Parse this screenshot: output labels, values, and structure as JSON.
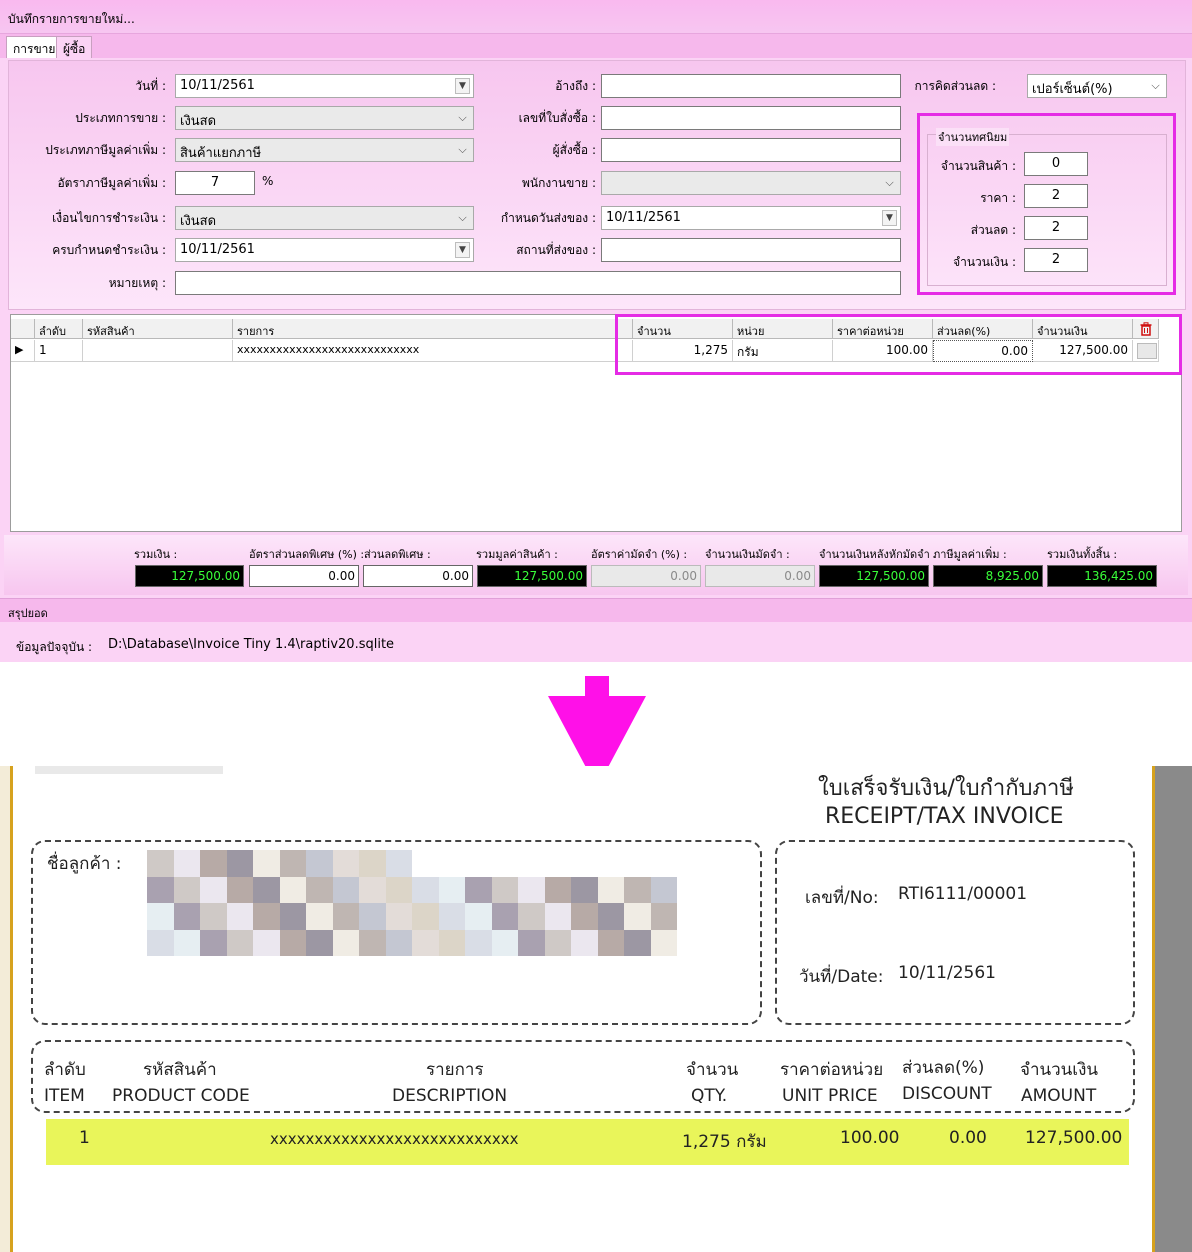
{
  "window": {
    "title": "บันทึกรายการขายใหม่..."
  },
  "tabs": [
    {
      "label": "การขาย",
      "active": true
    },
    {
      "label": "ผู้ซื้อ",
      "active": false
    }
  ],
  "form": {
    "date_label": "วันที่ :",
    "date_value": "10/11/2561",
    "sale_type_label": "ประเภทการขาย :",
    "sale_type_value": "เงินสด",
    "vat_type_label": "ประเภทภาษีมูลค่าเพิ่ม :",
    "vat_type_value": "สินค้าแยกภาษี",
    "vat_rate_label": "อัตราภาษีมูลค่าเพิ่ม :",
    "vat_rate_value": "7",
    "vat_rate_unit": "%",
    "payment_terms_label": "เงื่อนไขการชำระเงิน :",
    "payment_terms_value": "เงินสด",
    "due_date_label": "ครบกำหนดชำระเงิน :",
    "due_date_value": "10/11/2561",
    "remark_label": "หมายเหตุ :",
    "remark_value": "",
    "reference_label": "อ้างถึง :",
    "reference_value": "",
    "po_number_label": "เลขที่ใบสั่งซื้อ :",
    "po_number_value": "",
    "orderer_label": "ผู้สั่งซื้อ :",
    "orderer_value": "",
    "salesperson_label": "พนักงานขาย :",
    "salesperson_value": "",
    "delivery_date_label": "กำหนดวันส่งของ :",
    "delivery_date_value": "10/11/2561",
    "delivery_place_label": "สถานที่ส่งของ :",
    "delivery_place_value": "",
    "discount_calc_label": "การคิดส่วนลด :",
    "discount_calc_value": "เปอร์เซ็นต์(%)"
  },
  "decimals": {
    "title": "จำนวนทศนิยม",
    "qty_label": "จำนวนสินค้า :",
    "qty_value": "0",
    "price_label": "ราคา :",
    "price_value": "2",
    "discount_label": "ส่วนลด :",
    "discount_value": "2",
    "amount_label": "จำนวนเงิน :",
    "amount_value": "2"
  },
  "grid": {
    "headers": {
      "seq": "ลำดับ",
      "code": "รหัสสินค้า",
      "desc": "รายการ",
      "qty": "จำนวน",
      "unit": "หน่วย",
      "price": "ราคาต่อหน่วย",
      "disc": "ส่วนลด(%)",
      "amount": "จำนวนเงิน"
    },
    "rows": [
      {
        "seq": "1",
        "code": "",
        "desc": "xxxxxxxxxxxxxxxxxxxxxxxxxxxx",
        "qty": "1,275",
        "unit": "กรัม",
        "price": "100.00",
        "disc": "0.00",
        "amount": "127,500.00"
      }
    ]
  },
  "summary": {
    "total_label": "รวมเงิน :",
    "total_value": "127,500.00",
    "special_disc_rate_label": "อัตราส่วนลดพิเศษ (%) :",
    "special_disc_rate_value": "0.00",
    "special_disc_label": "ส่วนลดพิเศษ :",
    "special_disc_value": "0.00",
    "goods_value_label": "รวมมูลค่าสินค้า :",
    "goods_value_value": "127,500.00",
    "deposit_rate_label": "อัตราค่ามัดจำ (%) :",
    "deposit_rate_value": "0.00",
    "deposit_label": "จำนวนเงินมัดจำ :",
    "deposit_value": "0.00",
    "after_deposit_label": "จำนวนเงินหลังหักมัดจำ :",
    "after_deposit_value": "127,500.00",
    "vat_label": "ภาษีมูลค่าเพิ่ม :",
    "vat_value": "8,925.00",
    "grand_total_label": "รวมเงินทั้งสิ้น :",
    "grand_total_value": "136,425.00"
  },
  "footer": {
    "label": "สรุปยอด"
  },
  "status": {
    "label": "ข้อมูลปัจจุบัน :",
    "path": "D:\\Database\\Invoice Tiny 1.4\\raptiv20.sqlite"
  },
  "receipt": {
    "title_th": "ใบเสร็จรับเงิน/ใบกำกับภาษี",
    "title_en": "RECEIPT/TAX INVOICE",
    "customer_label": "ชื่อลูกค้า :",
    "no_label": "เลขที่/No:",
    "no_value": "RTI6111/00001",
    "date_label": "วันที่/Date:",
    "date_value": "10/11/2561",
    "headers_th": {
      "item": "ลำดับ",
      "code": "รหัสสินค้า",
      "desc": "รายการ",
      "qty": "จำนวน",
      "price": "ราคาต่อหน่วย",
      "disc": "ส่วนลด(%)",
      "amount": "จำนวนเงิน"
    },
    "headers_en": {
      "item": "ITEM",
      "code": "PRODUCT CODE",
      "desc": "DESCRIPTION",
      "qty": "QTY.",
      "price": "UNIT PRICE",
      "disc": "DISCOUNT",
      "amount": "AMOUNT"
    },
    "row": {
      "item": "1",
      "desc": "xxxxxxxxxxxxxxxxxxxxxxxxxxxx",
      "qty": "1,275 กรัม",
      "price": "100.00",
      "disc": "0.00",
      "amount": "127,500.00"
    }
  },
  "colors": {
    "app_bg": "#fbd3f5",
    "highlight": "#e52be5",
    "arrow": "#ff10e8",
    "row_highlight": "#e9f55a",
    "total_text": "#39ff39"
  }
}
